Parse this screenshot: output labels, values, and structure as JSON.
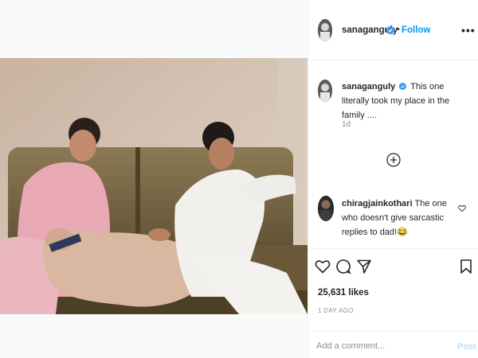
{
  "post": {
    "username": "sanaganguly",
    "follow_label": "Follow",
    "header_separator": "•",
    "more_label": "•••",
    "caption_username": "sanaganguly",
    "caption_text": "This one literally took my place in the family ....",
    "caption_time": "1d",
    "comment": {
      "username": "chiragjainkothari",
      "text": "The one who doesn't give sarcastic replies to dad!😂"
    },
    "likes_label": "25,631 likes",
    "posted_label": "1 DAY AGO",
    "add_comment_placeholder": "Add a comment...",
    "post_label": "Post"
  },
  "icons": {
    "verified": "verified-badge-icon",
    "load_more": "plus-circle-icon",
    "like": "heart-icon",
    "comment": "comment-bubble-icon",
    "share": "paper-plane-icon",
    "save": "bookmark-icon",
    "comment_like": "small-heart-icon"
  },
  "colors": {
    "accent": "#0095f6",
    "text": "#262626",
    "secondary_text": "#8e8e8e",
    "post_disabled": "#b2dffc"
  }
}
